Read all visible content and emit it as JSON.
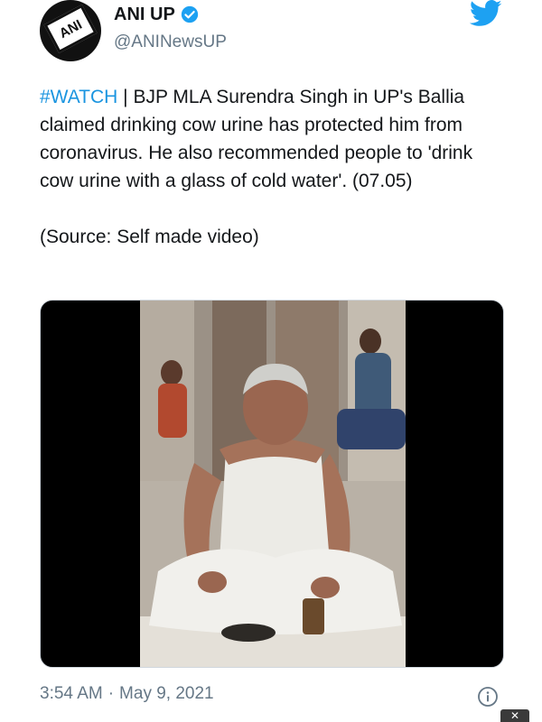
{
  "tweet": {
    "author": {
      "display_name": "ANI UP",
      "handle": "@ANINewsUP",
      "avatar_text": "ANI",
      "verified": true
    },
    "text": {
      "hashtag": "#WATCH",
      "body": " | BJP MLA Surendra Singh in UP's Ballia claimed drinking cow urine has protected him from coronavirus. He also recommended people to 'drink cow urine with a glass of cold water'. (07.05)",
      "source": "(Source: Self made video)"
    },
    "time": "3:54 AM",
    "separator": "·",
    "date": "May 9, 2021"
  },
  "colors": {
    "link": "#1b95e0",
    "verified": "#1da1f2",
    "twitter_brand": "#1da1f2",
    "secondary_text": "#657786"
  },
  "icons": {
    "verified": "verified-badge-icon",
    "brand": "twitter-bird-icon",
    "info": "info-icon",
    "close": "close-icon"
  },
  "overlay": {
    "close_symbol": "✕"
  }
}
